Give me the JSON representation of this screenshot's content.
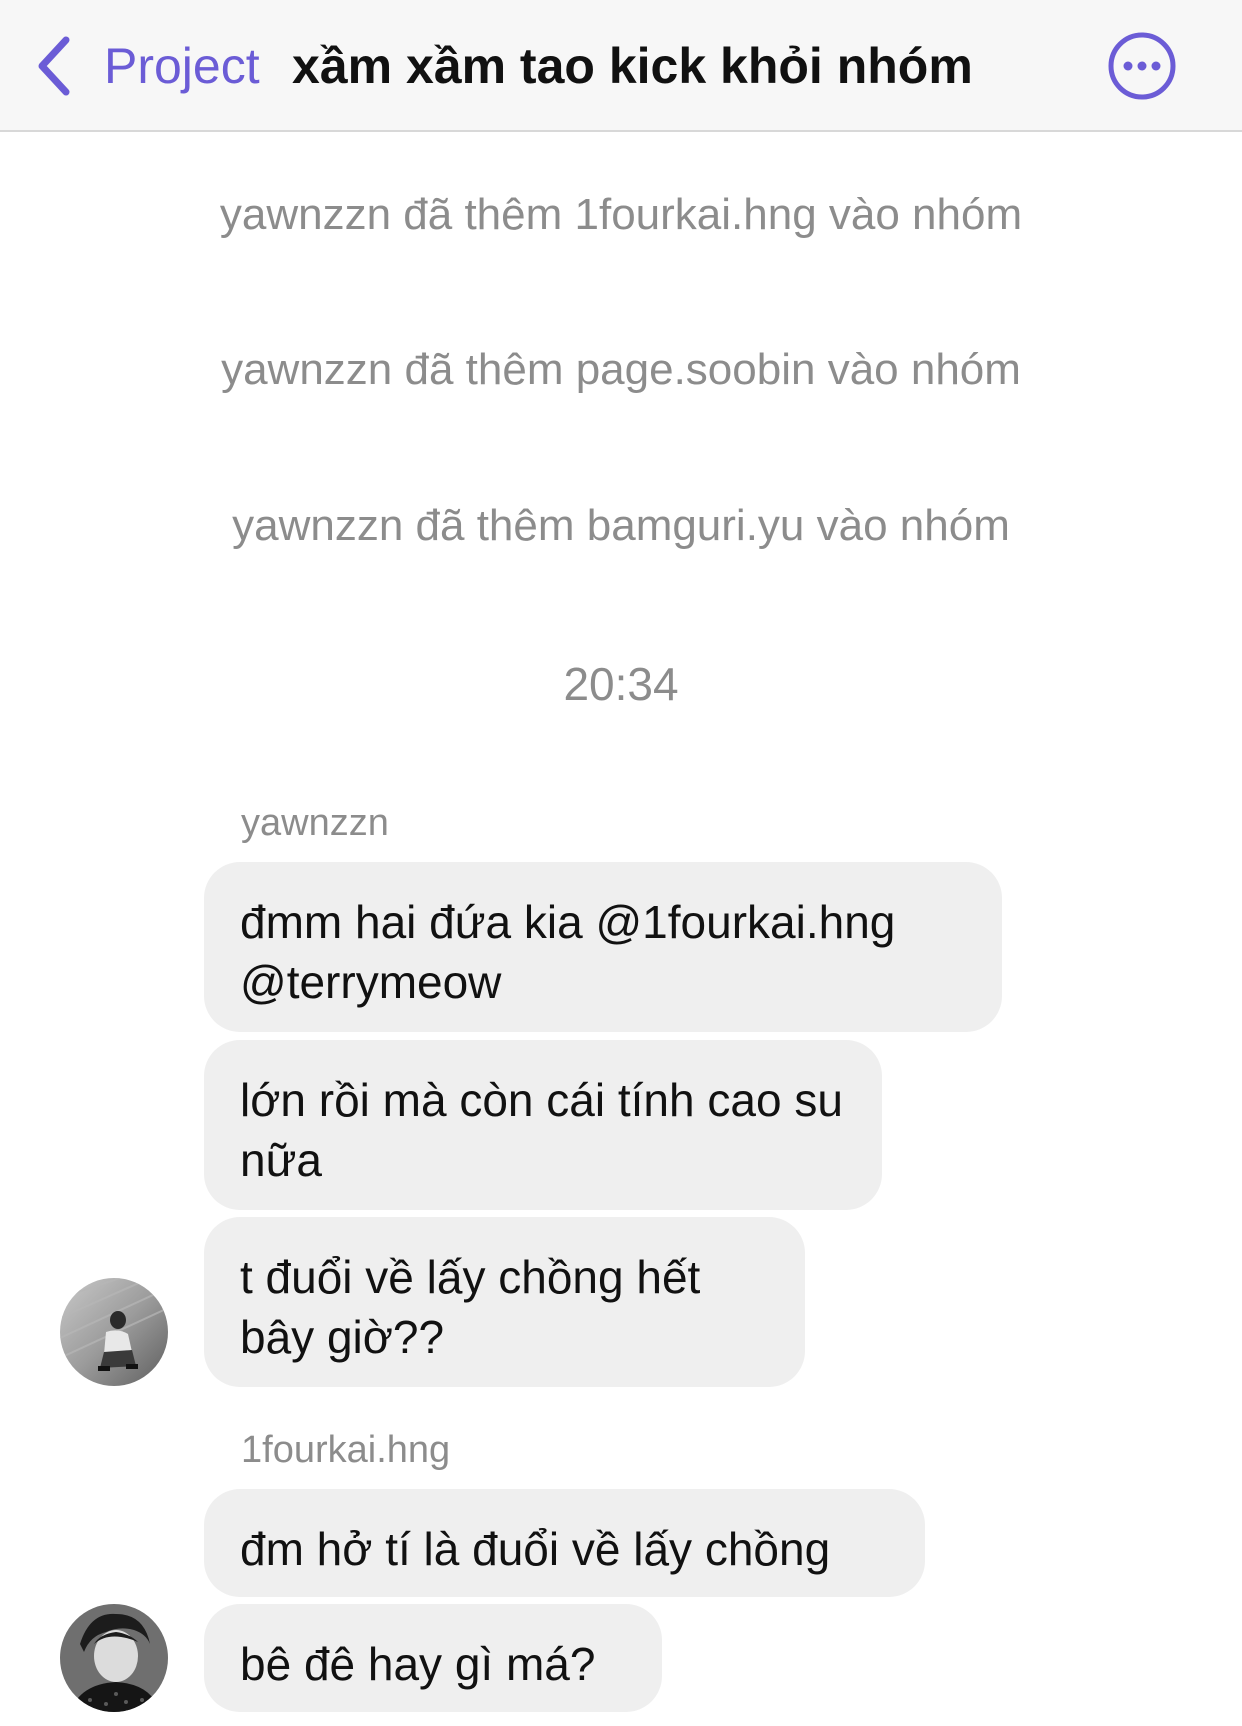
{
  "header": {
    "back_label": "Project",
    "title": "xầm xầm tao kick khỏi nhóm",
    "accent_color": "#6b5cd6",
    "back_icon": "chevron-left-icon",
    "more_icon": "more-horizontal-circle-icon"
  },
  "system_messages": [
    "yawnzzn đã thêm 1fourkai.hng vào nhóm",
    "yawnzzn đã thêm page.soobin vào nhóm",
    "yawnzzn đã thêm bamguri.yu vào nhóm"
  ],
  "timestamp": "20:34",
  "groups": [
    {
      "sender": "yawnzzn",
      "messages": [
        "đmm hai đứa kia @1fourkai.hng @terrymeow",
        "lớn rồi mà còn cái tính cao su nữa",
        "t đuổi về lấy chồng hết bây giờ??"
      ]
    },
    {
      "sender": "1fourkai.hng",
      "messages": [
        "đm hở tí là đuổi về lấy chồng",
        "bê đê hay gì má?"
      ]
    }
  ]
}
